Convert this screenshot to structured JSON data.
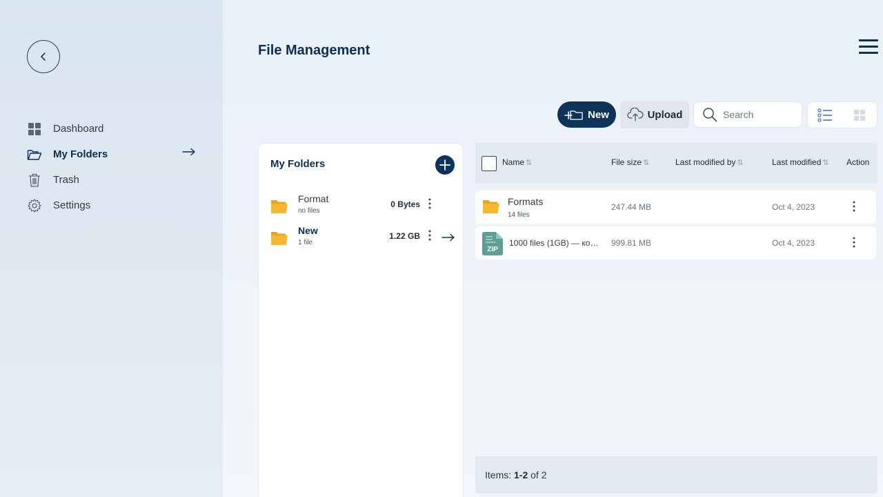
{
  "header": {
    "title": "File Management"
  },
  "sidebar": {
    "items": [
      {
        "label": "Dashboard",
        "icon": "grid-icon"
      },
      {
        "label": "My Folders",
        "icon": "folder-open-icon",
        "active": true
      },
      {
        "label": "Trash",
        "icon": "trash-icon"
      },
      {
        "label": "Settings",
        "icon": "gear-icon"
      }
    ]
  },
  "toolbar": {
    "new_label": "New",
    "upload_label": "Upload",
    "search_placeholder": "Search"
  },
  "folders_panel": {
    "title": "My Folders",
    "folders": [
      {
        "name": "Format",
        "subtitle": "no files",
        "size": "0 Bytes"
      },
      {
        "name": "New",
        "subtitle": "1 file",
        "size": "1.22 GB",
        "active": true
      }
    ]
  },
  "table": {
    "columns": [
      "Name",
      "File size",
      "Last modified by",
      "Last modified",
      "Action"
    ],
    "rows": [
      {
        "type": "folder",
        "name": "Formats",
        "subtitle": "14 files",
        "size": "247.44 MB",
        "modified_by": "",
        "modified": "Oct 4, 2023"
      },
      {
        "type": "zip",
        "name": "1000 files (1GB) — коп…",
        "size": "999.81 MB",
        "modified_by": "",
        "modified": "Oct 4, 2023",
        "icon_label": "ZIP"
      }
    ]
  },
  "footer": {
    "prefix": "Items: ",
    "range": "1-2",
    "suffix": " of 2"
  },
  "colors": {
    "primary": "#0d3358",
    "folder": "#f5b82e",
    "zip": "#5e9e95"
  }
}
